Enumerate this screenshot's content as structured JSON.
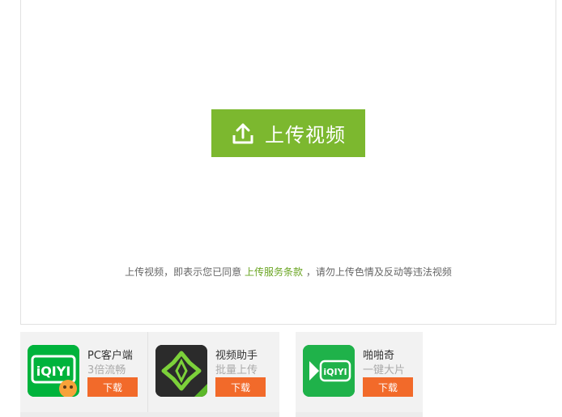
{
  "upload": {
    "button_label": "上传视频",
    "terms_prefix": "上传视频，即表示您已同意",
    "terms_link": "上传服务条款",
    "terms_suffix": "，请勿上传色情及反动等违法视频"
  },
  "apps": [
    {
      "title": "PC客户端",
      "subtitle": "3倍流畅",
      "button": "下载",
      "icon": "iqiyi-logo-icon",
      "icon_text": "iQIYI"
    },
    {
      "title": "视频助手",
      "subtitle": "批量上传",
      "button": "下载",
      "icon": "video-assistant-icon"
    },
    {
      "title": "啪啪奇",
      "subtitle": "一键大片",
      "button": "下载",
      "icon": "papaqi-icon",
      "icon_text": "iQIYI"
    }
  ],
  "colors": {
    "upload_green": "#7cb82f",
    "download_orange": "#f26a2a",
    "link_green": "#6aa522"
  }
}
